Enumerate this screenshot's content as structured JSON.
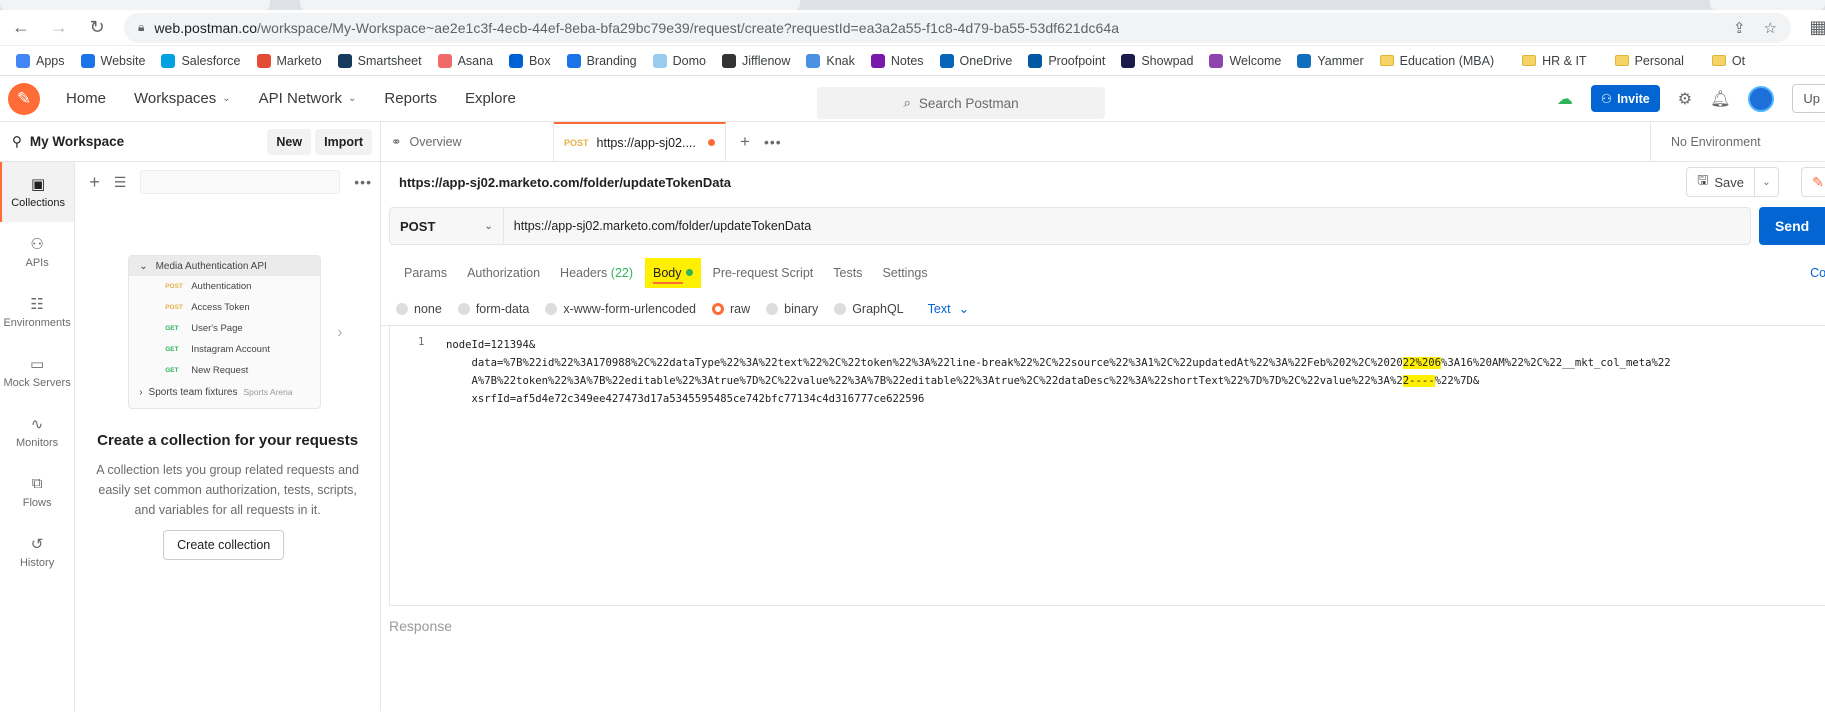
{
  "browser": {
    "url_host": "web.postman.co",
    "url_path": "/workspace/My-Workspace~ae2e1c3f-4ecb-44ef-8eba-bfa29bc79e39/request/create?requestId=ea3a2a55-f1c8-4d79-ba55-53df621dc64a",
    "bookmarks": [
      {
        "label": "Apps",
        "color": "#4285f4"
      },
      {
        "label": "Website",
        "color": "#1a73e8"
      },
      {
        "label": "Salesforce",
        "color": "#00a1e0"
      },
      {
        "label": "Marketo",
        "color": "#e34b33"
      },
      {
        "label": "Smartsheet",
        "color": "#163a5f"
      },
      {
        "label": "Asana",
        "color": "#f06a6a"
      },
      {
        "label": "Box",
        "color": "#0061d5"
      },
      {
        "label": "Branding",
        "color": "#1a73e8"
      },
      {
        "label": "Domo",
        "color": "#99ccee"
      },
      {
        "label": "Jifflenow",
        "color": "#333333"
      },
      {
        "label": "Knak",
        "color": "#4a90e2"
      },
      {
        "label": "Notes",
        "color": "#7719aa"
      },
      {
        "label": "OneDrive",
        "color": "#0364b8"
      },
      {
        "label": "Proofpoint",
        "color": "#0058a3"
      },
      {
        "label": "Showpad",
        "color": "#1b1b4b"
      },
      {
        "label": "Welcome",
        "color": "#8e44ad"
      },
      {
        "label": "Yammer",
        "color": "#106ebe"
      }
    ],
    "folders": [
      "Education (MBA)",
      "HR & IT",
      "Personal"
    ],
    "folder_trailing": "Ot"
  },
  "header": {
    "nav": [
      {
        "label": "Home",
        "caret": false
      },
      {
        "label": "Workspaces",
        "caret": true
      },
      {
        "label": "API Network",
        "caret": true
      },
      {
        "label": "Reports",
        "caret": false
      },
      {
        "label": "Explore",
        "caret": false
      }
    ],
    "search_placeholder": "Search Postman",
    "invite_label": "Invite",
    "upgrade_label": "Up"
  },
  "workspace": {
    "title": "My Workspace",
    "new_label": "New",
    "import_label": "Import"
  },
  "sidebar": [
    {
      "label": "Collections",
      "icon": "▣",
      "active": true
    },
    {
      "label": "APIs",
      "icon": "⚇",
      "active": false
    },
    {
      "label": "Environments",
      "icon": "☷",
      "active": false
    },
    {
      "label": "Mock Servers",
      "icon": "▭",
      "active": false
    },
    {
      "label": "Monitors",
      "icon": "∿",
      "active": false
    },
    {
      "label": "Flows",
      "icon": "⧉",
      "active": false
    },
    {
      "label": "History",
      "icon": "↺",
      "active": false
    }
  ],
  "illustration": {
    "collection_name": "Media Authentication API",
    "requests": [
      {
        "method": "POST",
        "name": "Authentication"
      },
      {
        "method": "POST",
        "name": "Access Token"
      },
      {
        "method": "GET",
        "name": "User's Page"
      },
      {
        "method": "GET",
        "name": "Instagram Account"
      },
      {
        "method": "GET",
        "name": "New Request"
      }
    ],
    "footer_name": "Sports team fixtures",
    "footer_sub": "Sports Arena"
  },
  "empty_state": {
    "title": "Create a collection for your requests",
    "description": "A collection lets you group related requests and easily set common authorization, tests, scripts, and variables for all requests in it.",
    "button": "Create collection"
  },
  "tabs": {
    "overview_label": "Overview",
    "active_method": "POST",
    "active_label": "https://app-sj02....",
    "environment": "No Environment"
  },
  "request": {
    "title": "https://app-sj02.marketo.com/folder/updateTokenData",
    "save_label": "Save",
    "method": "POST",
    "url": "https://app-sj02.marketo.com/folder/updateTokenData",
    "send_label": "Send",
    "subtabs": [
      {
        "label": "Params",
        "count": ""
      },
      {
        "label": "Authorization",
        "count": ""
      },
      {
        "label": "Headers",
        "count": "(22)"
      },
      {
        "label": "Body",
        "count": "",
        "active": true
      },
      {
        "label": "Pre-request Script",
        "count": ""
      },
      {
        "label": "Tests",
        "count": ""
      },
      {
        "label": "Settings",
        "count": ""
      }
    ],
    "cookies_label": "Coo",
    "body_types": [
      {
        "label": "none",
        "selected": false
      },
      {
        "label": "form-data",
        "selected": false
      },
      {
        "label": "x-www-form-urlencoded",
        "selected": false
      },
      {
        "label": "raw",
        "selected": true
      },
      {
        "label": "binary",
        "selected": false
      },
      {
        "label": "GraphQL",
        "selected": false
      }
    ],
    "text_format": "Text",
    "line_number": "1",
    "body_line1": "nodeId=121394&",
    "body_line2a": "    data=%7B%22id%22%3A170988%2C%22dataType%22%3A%22text%22%2C%22token%22%3A%22line-break%22%2C%22source%22%3A1%2C%22updatedAt%22%3A%22Feb%202%2C%2020",
    "body_line2_hl": "22%206",
    "body_line2b": "%3A16%20AM%22%2C%22__mkt_col_meta%22",
    "body_line3a": "    A%7B%22token%22%3A%7B%22editable%22%3Atrue%7D%2C%22value%22%3A%7B%22editable%22%3Atrue%2C%22dataDesc%22%3A%22shortText%22%7D%7D%2C%22value%22%3A%2",
    "body_line3_hl": "2----",
    "body_line3b": "%22%7D&",
    "body_line4": "    xsrfId=af5d4e72c349ee427473d17a5345595485ce742bfc77134c4d316777ce622596",
    "response_label": "Response"
  }
}
